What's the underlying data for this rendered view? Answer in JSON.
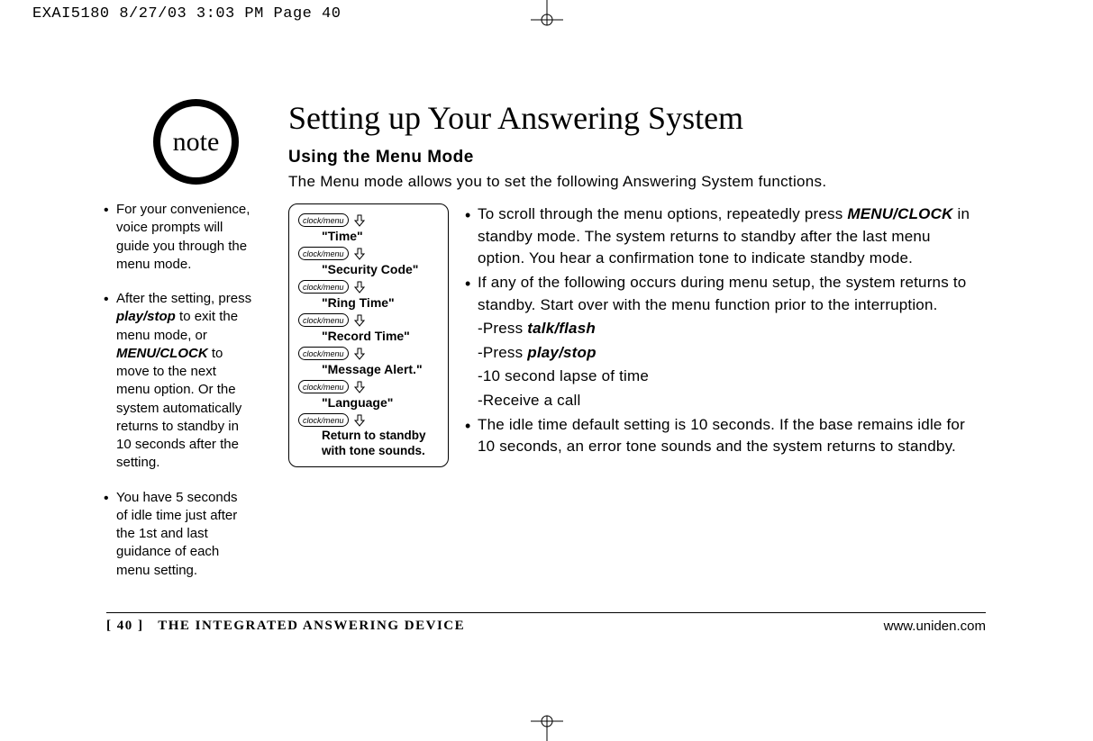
{
  "slug": "EXAI5180  8/27/03 3:03 PM  Page 40",
  "note_label": "note",
  "side_notes": {
    "n1_a": "For your convenience, voice prompts will guide you through the menu mode.",
    "n2_a": "After the setting, press ",
    "n2_b": "play/stop",
    "n2_c": " to exit the menu mode, or ",
    "n2_d": "MENU/CLOCK",
    "n2_e": " to move to the next menu option. Or the system automatically returns to standby in 10 seconds after the setting.",
    "n3_a": "You have 5 seconds of idle time just after the 1st and last guidance of each menu setting."
  },
  "title": "Setting up Your Answering System",
  "subtitle": "Using the Menu Mode",
  "intro": "The Menu mode allows you to set the following Answering System functions.",
  "menu_button": "clock/menu",
  "menu_items": {
    "m1": "\"Time\"",
    "m2": "\"Security Code\"",
    "m3": "\"Ring Time\"",
    "m4": "\"Record Time\"",
    "m5": "\"Message Alert.\"",
    "m6": "\"Language\"",
    "return": "Return to standby with tone sounds."
  },
  "right": {
    "b1_a": "To scroll through the menu options, repeatedly press ",
    "b1_b": "MENU/CLOCK",
    "b1_c": " in standby mode. The system returns to standby after the last menu option. You hear a confirmation tone to indicate standby mode.",
    "b2": "If any of the following occurs during menu setup, the system returns to standby. Start over with the menu function prior to the interruption.",
    "d1_a": "-Press ",
    "d1_b": "talk/flash",
    "d2_a": "-Press ",
    "d2_b": "play/stop",
    "d3": "-10 second lapse of time",
    "d4": "-Receive a call",
    "b3": "The idle time default setting is 10 seconds. If the base remains idle for 10 seconds, an error tone sounds and the system returns to standby."
  },
  "footer": {
    "page": "[ 40 ]",
    "section": "THE INTEGRATED ANSWERING DEVICE",
    "url": "www.uniden.com"
  }
}
